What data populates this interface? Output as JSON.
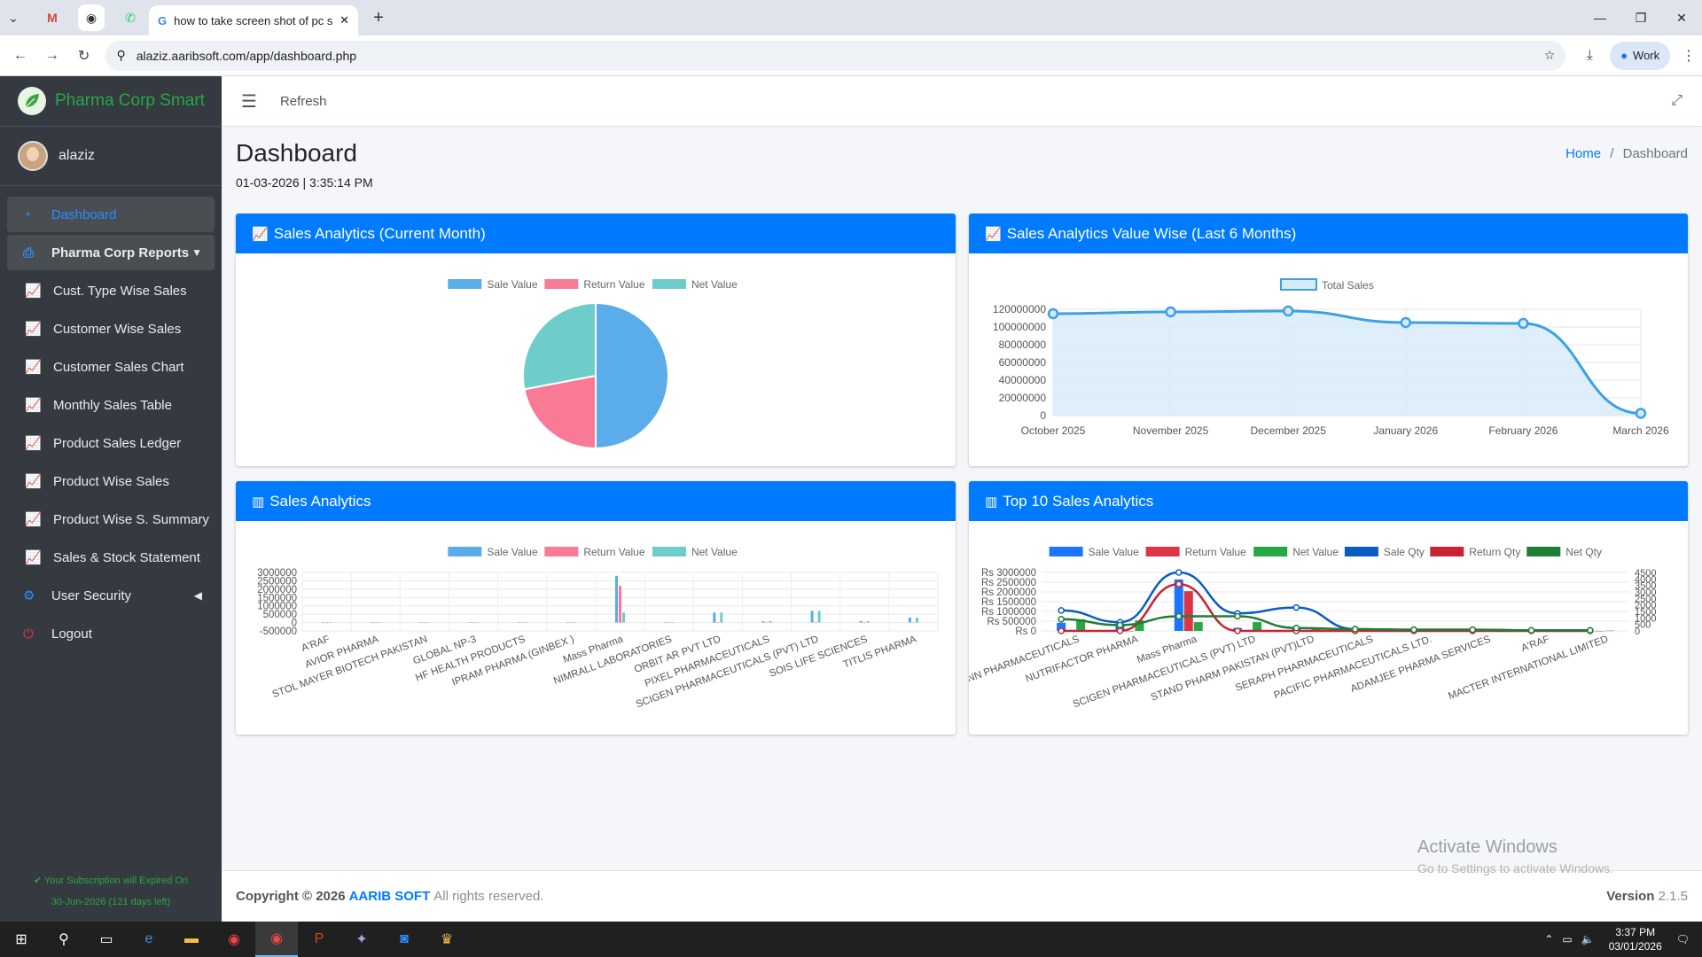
{
  "browser": {
    "tab_title": "how to take screen shot of pc s",
    "url": "alaziz.aaribsoft.com/app/dashboard.php",
    "profile_label": "Work"
  },
  "sidebar": {
    "brand": "Pharma Corp Smart",
    "user": "alaziz",
    "items": [
      {
        "label": "Dashboard",
        "icon": "dashboard-icon"
      },
      {
        "label": "Pharma Corp Reports",
        "icon": "print-icon"
      },
      {
        "label": "Cust. Type Wise Sales",
        "icon": "chart-line-icon"
      },
      {
        "label": "Customer Wise Sales",
        "icon": "chart-line-icon"
      },
      {
        "label": "Customer Sales Chart",
        "icon": "chart-line-icon"
      },
      {
        "label": "Monthly Sales Table",
        "icon": "chart-line-icon"
      },
      {
        "label": "Product Sales Ledger",
        "icon": "chart-line-icon"
      },
      {
        "label": "Product Wise Sales",
        "icon": "chart-line-icon"
      },
      {
        "label": "Product Wise S. Summary",
        "icon": "chart-line-icon"
      },
      {
        "label": "Sales & Stock Statement",
        "icon": "chart-line-icon"
      },
      {
        "label": "User Security",
        "icon": "gear-icon"
      },
      {
        "label": "Logout",
        "icon": "power-icon"
      }
    ],
    "subscription_line1": "Your Subscription will Expired On",
    "subscription_line2": "30-Jun-2026 (121 days left)"
  },
  "topnav": {
    "refresh": "Refresh"
  },
  "page": {
    "title": "Dashboard",
    "datetime": "01-03-2026 | 3:35:14 PM",
    "breadcrumb_home": "Home",
    "breadcrumb_sep": "/",
    "breadcrumb_current": "Dashboard"
  },
  "cards": {
    "c1": "Sales Analytics (Current Month)",
    "c2": "Sales Analytics Value Wise (Last 6 Months)",
    "c3": "Sales Analytics",
    "c4": "Top 10 Sales Analytics"
  },
  "chart_data": [
    {
      "type": "pie",
      "legend": [
        "Sale Value",
        "Return Value",
        "Net Value"
      ],
      "values": [
        50,
        22,
        28
      ],
      "colors": [
        "#5aade9",
        "#f97a95",
        "#6ecdcb"
      ]
    },
    {
      "type": "area",
      "series": [
        {
          "name": "Total Sales",
          "values": [
            115000000,
            117000000,
            118000000,
            105000000,
            104000000,
            2500000
          ]
        }
      ],
      "categories": [
        "October 2025",
        "November 2025",
        "December 2025",
        "January 2026",
        "February 2026",
        "March 2026"
      ],
      "y_ticks": [
        "120000000",
        "100000000",
        "80000000",
        "60000000",
        "40000000",
        "20000000",
        "0"
      ],
      "ylim": [
        0,
        120000000
      ],
      "color": "#3ea0e4"
    },
    {
      "type": "bar",
      "legend": [
        "Sale Value",
        "Return Value",
        "Net Value"
      ],
      "y_ticks": [
        "3000000",
        "2500000",
        "2000000",
        "1500000",
        "1000000",
        "500000",
        "0",
        "-500000"
      ],
      "ylim": [
        -500000,
        3000000
      ],
      "x_labels": [
        "A'RAF",
        "AVIOR PHARMA",
        "STOL MAYER BIOTECH PAKISTAN",
        "GLOBAL NP-3",
        "HF HEALTH PRODUCTS",
        "IPRAM PHARMA (GINBEX )",
        "Mass Pharma",
        "NIMRALL LABORATORIES",
        "ORBIT AR PVT LTD",
        "PIXEL PHARMACEUTICALS",
        "SCIGEN PHARMACEUTICALS (PVT) LTD",
        "SOIS LIFE SCIENCES",
        "TITLIS PHARMA"
      ],
      "sale_values": [
        20000,
        15000,
        10000,
        12000,
        8000,
        9000,
        2800000,
        15000,
        600000,
        80000,
        700000,
        90000,
        300000
      ],
      "return_values": [
        0,
        0,
        0,
        0,
        0,
        0,
        2200000,
        0,
        0,
        0,
        0,
        0,
        0
      ],
      "net_values": [
        20000,
        15000,
        10000,
        12000,
        8000,
        9000,
        600000,
        15000,
        600000,
        80000,
        700000,
        90000,
        300000
      ]
    },
    {
      "type": "bar",
      "legend": [
        "Sale Value",
        "Return Value",
        "Net Value",
        "Sale Qty",
        "Return Qty",
        "Net Qty"
      ],
      "y_ticks": [
        "Rs 3000000",
        "Rs 2500000",
        "Rs 2000000",
        "Rs 1500000",
        "Rs 1000000",
        "Rs 500000",
        "Rs 0"
      ],
      "y2_ticks": [
        "4500",
        "4000",
        "3500",
        "3000",
        "2500",
        "2000",
        "1500",
        "1000",
        "500",
        "0"
      ],
      "x_labels": [
        "SCOTMANN PHARMACEUTICALS",
        "NUTRIFACTOR PHARMA",
        "Mass Pharma",
        "SCIGEN PHARMACEUTICALS (PVT) LTD",
        "STAND PHARM PAKISTAN (PVT)LTD",
        "SERAPH PHARMACEUTICALS",
        "PACIFIC PHARMACEUTICALS LTD.",
        "ADAMJEE PHARMA SERVICES",
        "A'RAF",
        "MACTER INTERNATIONAL LIMITED"
      ]
    }
  ],
  "footer": {
    "copyright": "Copyright © 2026",
    "brand": "AARIB SOFT",
    "rights": "All rights reserved.",
    "version_label": "Version",
    "version": "2.1.5"
  },
  "watermark": {
    "line1": "Activate Windows",
    "line2": "Go to Settings to activate Windows."
  },
  "taskbar": {
    "time": "3:37 PM",
    "date": "03/01/2026"
  }
}
